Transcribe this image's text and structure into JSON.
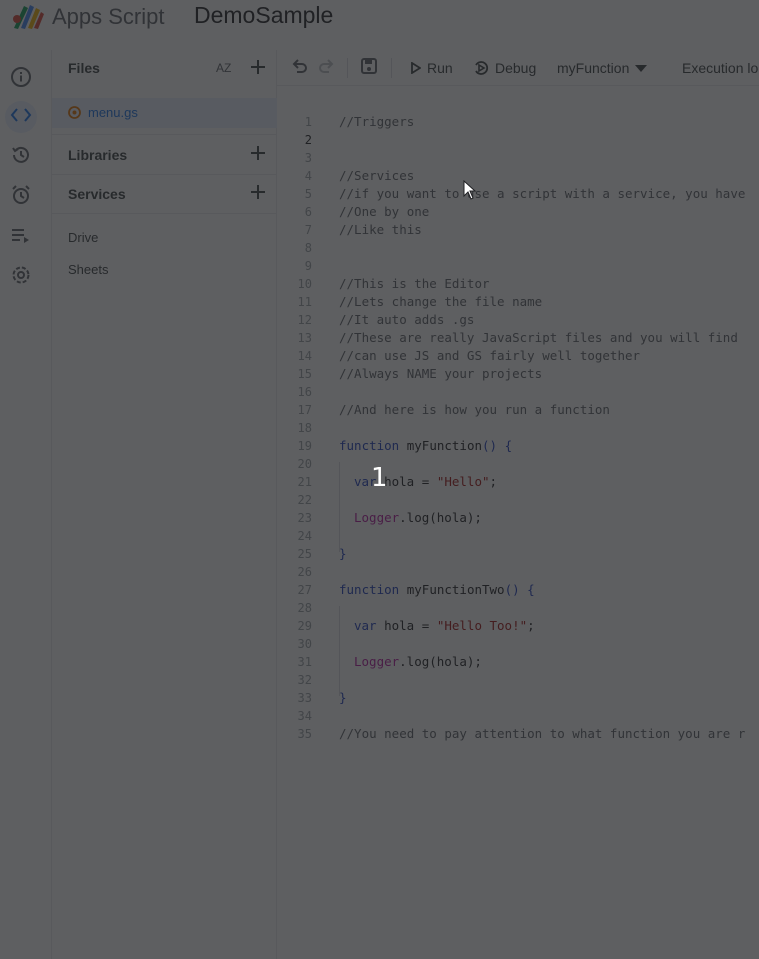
{
  "header": {
    "app_name": "Apps Script",
    "project_name": "DemoSample"
  },
  "rail": {
    "items": [
      {
        "icon": "info-icon"
      },
      {
        "icon": "code-editor-icon",
        "active": true
      },
      {
        "icon": "history-icon"
      },
      {
        "icon": "alarm-clock-icon"
      },
      {
        "icon": "executions-icon"
      },
      {
        "icon": "settings-icon"
      }
    ]
  },
  "files_panel": {
    "title": "Files",
    "sort_label": "AZ",
    "active_file": "menu.gs",
    "libraries_title": "Libraries",
    "services_title": "Services",
    "services": [
      "Drive",
      "Sheets"
    ]
  },
  "toolbar": {
    "run_label": "Run",
    "debug_label": "Debug",
    "function_select": "myFunction",
    "execution_log_label": "Execution lo"
  },
  "editor": {
    "current_line": 2,
    "lines": [
      "1",
      "2",
      "3",
      "4",
      "5",
      "6",
      "7",
      "8",
      "9",
      "10",
      "11",
      "12",
      "13",
      "14",
      "15",
      "16",
      "17",
      "18",
      "19",
      "20",
      "21",
      "22",
      "23",
      "24",
      "25",
      "26",
      "27",
      "28",
      "29",
      "30",
      "31",
      "32",
      "33",
      "34",
      "35"
    ],
    "code": {
      "l1": "//Triggers",
      "l4": "//Services",
      "l5": "//if you want to use a script with a service, you have",
      "l6": "//One by one",
      "l7": "//Like this",
      "l10": "//This is the Editor",
      "l11": "//Lets change the file name",
      "l12": "//It auto adds .gs",
      "l13": "//These are really JavaScript files and you will find",
      "l14": "//can use JS and GS fairly well together",
      "l15": "//Always NAME your projects",
      "l17": "//And here is how you run a function",
      "kw_function": "function",
      "fn1_name": "myFunction",
      "parens_open": "() {",
      "kw_var": "var",
      "var_name": "hola",
      "eq": "=",
      "str1": "\"Hello\"",
      "semi": ";",
      "logger": "Logger",
      "log_call": ".log(hola);",
      "close_brace": "}",
      "fn2_name": "myFunctionTwo",
      "str2": "\"Hello Too!\"",
      "l35": "//You need to pay attention to what function you are r"
    }
  },
  "overlay": {
    "step_number": "1"
  }
}
